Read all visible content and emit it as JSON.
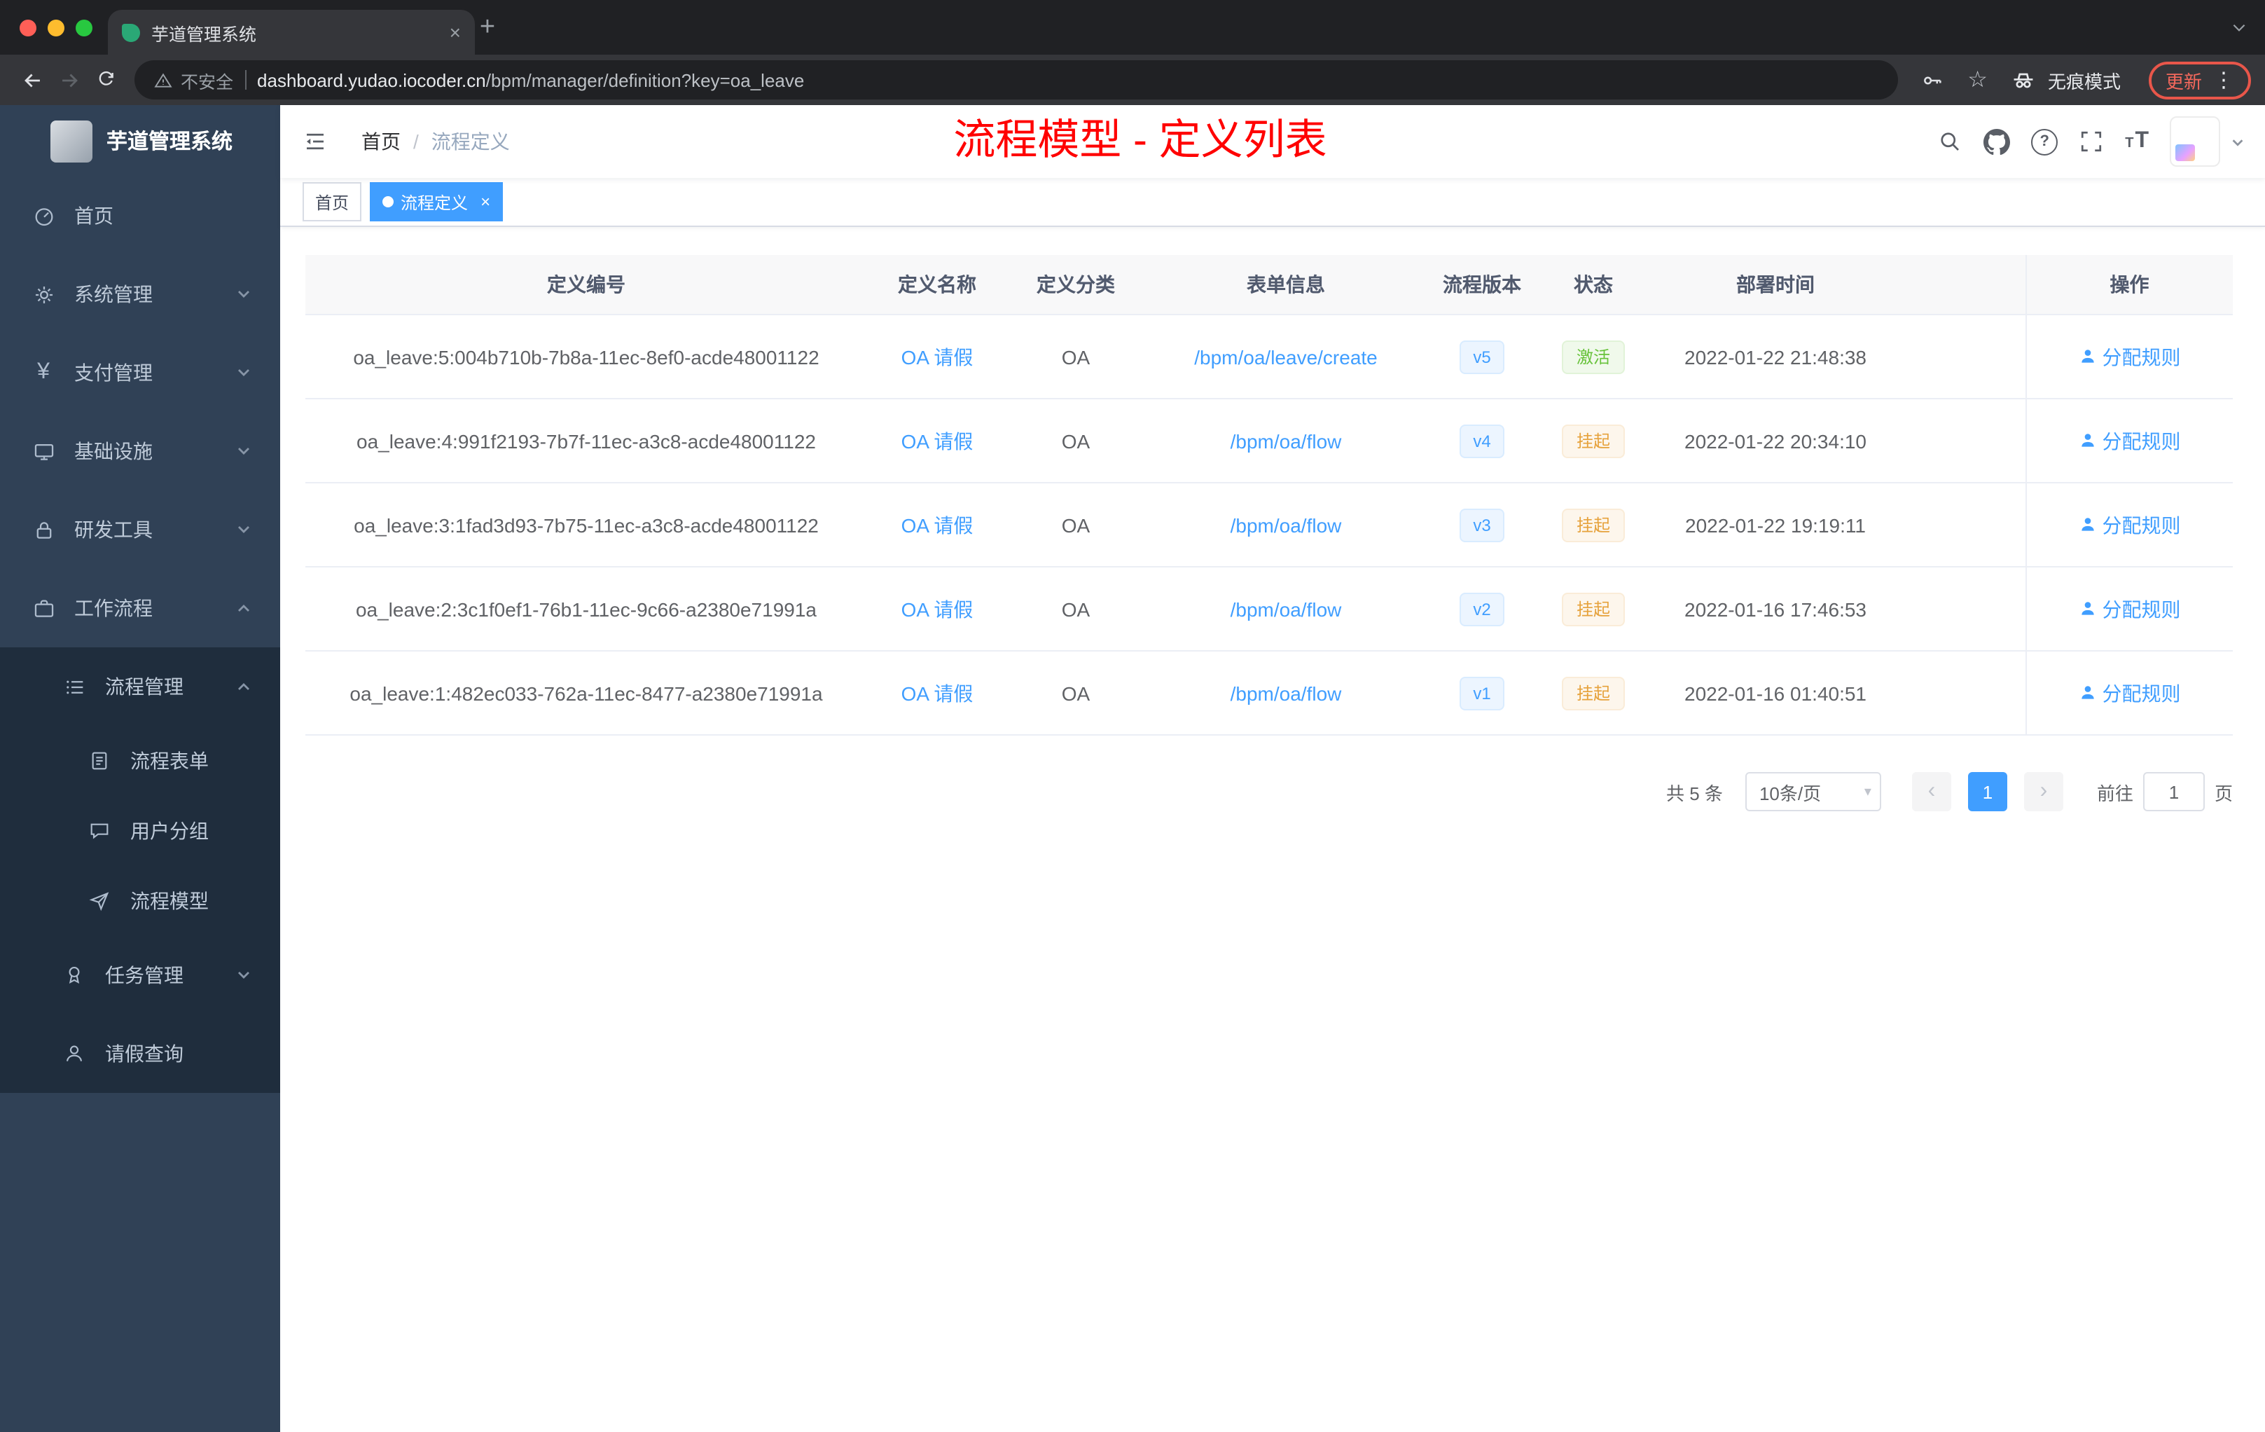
{
  "browser": {
    "tab_title": "芋道管理系统",
    "security_label": "不安全",
    "url_domain": "dashboard.yudao.iocoder.cn",
    "url_path": "/bpm/manager/definition?key=oa_leave",
    "incognito_label": "无痕模式",
    "update_label": "更新"
  },
  "glyphs": {
    "plus": "+",
    "close": "×",
    "star": "☆",
    "more": "⋮",
    "yen": "¥",
    "help": "?",
    "font_big": "T",
    "font_small": "T",
    "caret": "▾",
    "prev": "‹",
    "next": "›"
  },
  "sidebar": {
    "logo_title": "芋道管理系统",
    "items": [
      {
        "label": "首页"
      },
      {
        "label": "系统管理"
      },
      {
        "label": "支付管理"
      },
      {
        "label": "基础设施"
      },
      {
        "label": "研发工具"
      },
      {
        "label": "工作流程"
      },
      {
        "label": "流程管理"
      },
      {
        "label": "流程表单"
      },
      {
        "label": "用户分组"
      },
      {
        "label": "流程模型"
      },
      {
        "label": "任务管理"
      },
      {
        "label": "请假查询"
      }
    ]
  },
  "header": {
    "breadcrumb_home": "首页",
    "breadcrumb_sep": "/",
    "breadcrumb_current": "流程定义",
    "annotation": "流程模型 - 定义列表"
  },
  "tags": {
    "home": "首页",
    "active": "流程定义"
  },
  "table": {
    "columns": [
      "定义编号",
      "定义名称",
      "定义分类",
      "表单信息",
      "流程版本",
      "状态",
      "部署时间",
      "操作"
    ],
    "rows": [
      {
        "id": "oa_leave:5:004b710b-7b8a-11ec-8ef0-acde48001122",
        "name": "OA 请假",
        "category": "OA",
        "form": "/bpm/oa/leave/create",
        "version": "v5",
        "status": "激活",
        "time": "2022-01-22 21:48:38",
        "action": "分配规则"
      },
      {
        "id": "oa_leave:4:991f2193-7b7f-11ec-a3c8-acde48001122",
        "name": "OA 请假",
        "category": "OA",
        "form": "/bpm/oa/flow",
        "version": "v4",
        "status": "挂起",
        "time": "2022-01-22 20:34:10",
        "action": "分配规则"
      },
      {
        "id": "oa_leave:3:1fad3d93-7b75-11ec-a3c8-acde48001122",
        "name": "OA 请假",
        "category": "OA",
        "form": "/bpm/oa/flow",
        "version": "v3",
        "status": "挂起",
        "time": "2022-01-22 19:19:11",
        "action": "分配规则"
      },
      {
        "id": "oa_leave:2:3c1f0ef1-76b1-11ec-9c66-a2380e71991a",
        "name": "OA 请假",
        "category": "OA",
        "form": "/bpm/oa/flow",
        "version": "v2",
        "status": "挂起",
        "time": "2022-01-16 17:46:53",
        "action": "分配规则"
      },
      {
        "id": "oa_leave:1:482ec033-762a-11ec-8477-a2380e71991a",
        "name": "OA 请假",
        "category": "OA",
        "form": "/bpm/oa/flow",
        "version": "v1",
        "status": "挂起",
        "time": "2022-01-16 01:40:51",
        "action": "分配规则"
      }
    ]
  },
  "pagination": {
    "total": "共 5 条",
    "page_size": "10条/页",
    "current_page": "1",
    "goto_label": "前往",
    "goto_value": "1",
    "unit_label": "页"
  },
  "colors": {
    "accent": "#409eff",
    "annotation_red": "#ff0000",
    "status_active_green": "#67c23a",
    "status_suspend_orange": "#e6a23c",
    "sidebar_bg": "#304156",
    "submenu_bg": "#1f2d3d"
  }
}
